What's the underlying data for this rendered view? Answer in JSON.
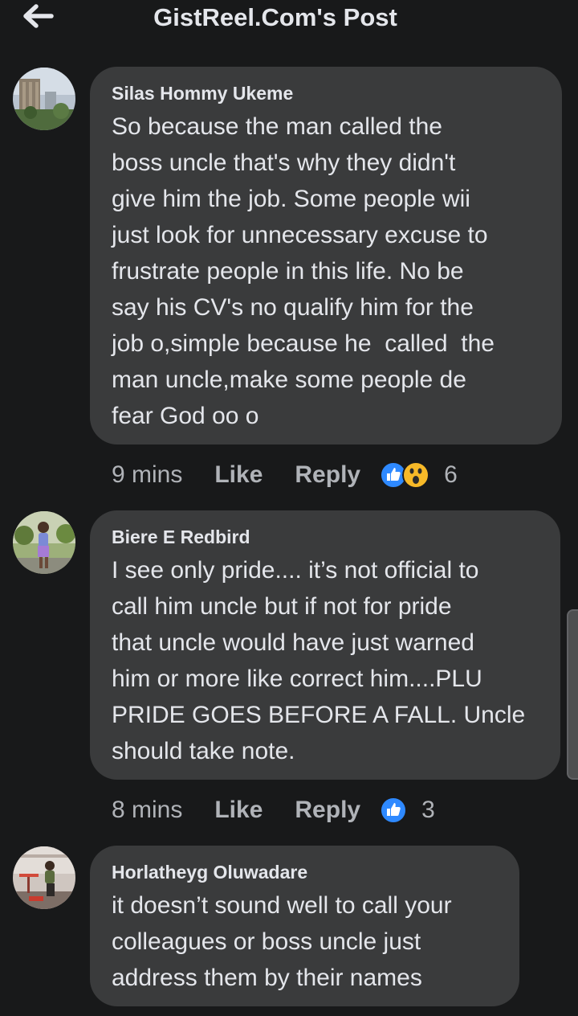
{
  "header": {
    "title": "GistReel.Com's Post",
    "back_icon": "arrow-left-icon"
  },
  "comments": [
    {
      "author": "Silas Hommy Ukeme",
      "text": "So because the man called the\nboss uncle that's why they didn't\ngive him the job. Some people wii\njust look for unnecessary excuse to\nfrustrate people in this life. No be\nsay his CV's no qualify him for the\njob o,simple because he  called  the\nman uncle,make some people de\nfear God oo o",
      "time": "9 mins",
      "like_label": "Like",
      "reply_label": "Reply",
      "reactions": [
        "like",
        "wow"
      ],
      "reaction_count": "6"
    },
    {
      "author": "Biere E Redbird",
      "text": "I see only pride.... it’s not official to\ncall him uncle but if not for pride\nthat uncle would have just warned\nhim or more like correct him....PLU\nPRIDE GOES BEFORE A FALL. Uncle\nshould take note.",
      "time": "8 mins",
      "like_label": "Like",
      "reply_label": "Reply",
      "reactions": [
        "like"
      ],
      "reaction_count": "3"
    },
    {
      "author": "Horlatheyg Oluwadare",
      "text": "it doesn’t sound well to call your\ncolleagues or boss uncle just\naddress them by their names"
    }
  ],
  "colors": {
    "background": "#18191a",
    "bubble": "#3a3b3c",
    "primary_text": "#e4e6eb",
    "secondary_text": "#b0b3b8",
    "like_blue": "#2e89ff",
    "wow_yellow": "#f7b928"
  }
}
